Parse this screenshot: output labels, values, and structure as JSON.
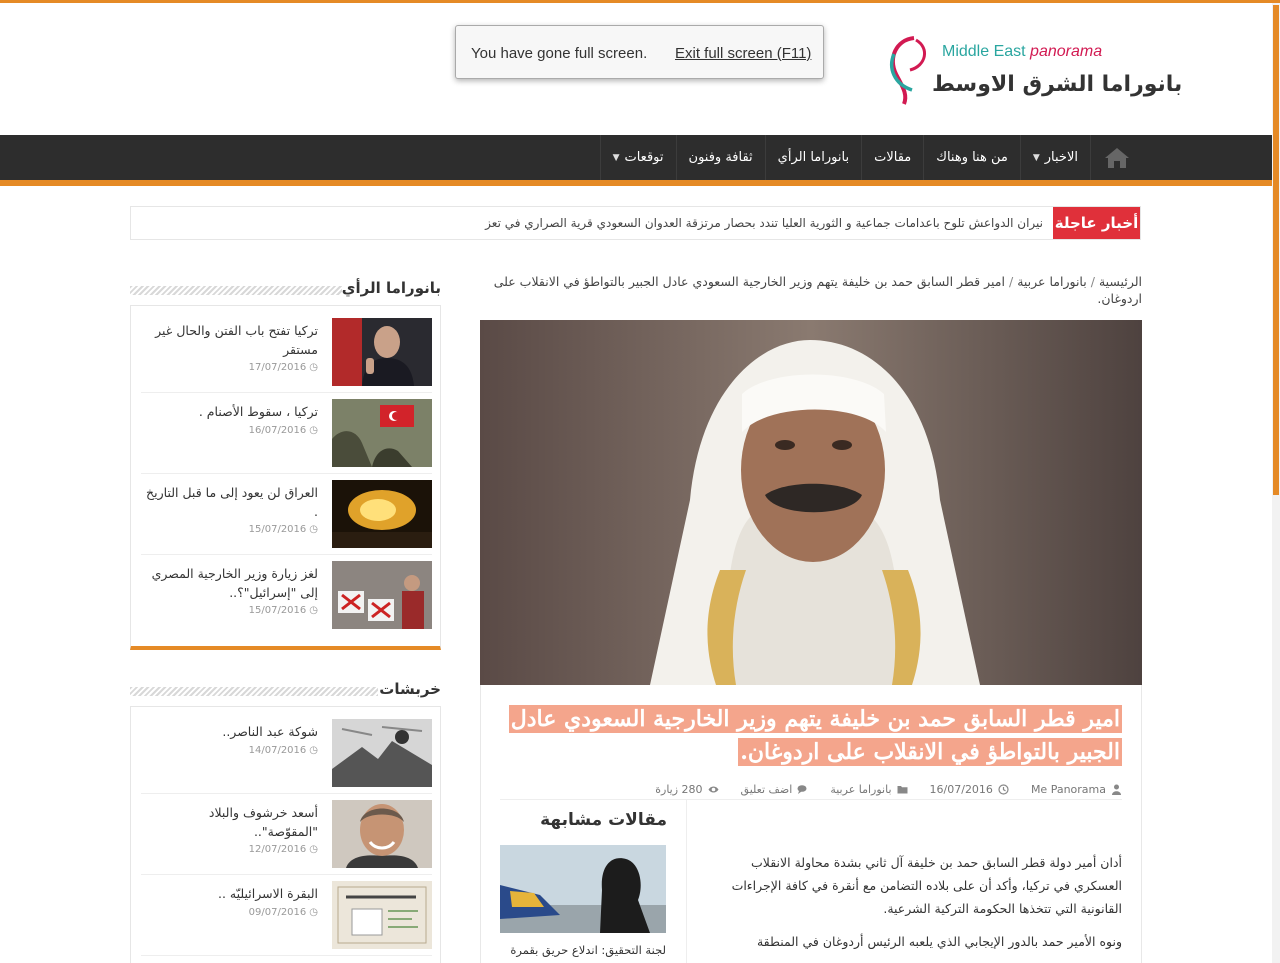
{
  "fullscreen_notice": {
    "message": "You have gone full screen.",
    "exit_label": "Exit full screen (F11)"
  },
  "logo": {
    "en_part1": "Middle East",
    "en_part2": "panorama",
    "ar": "بانوراما الشرق الاوسط"
  },
  "nav": {
    "items": [
      {
        "label": "الاخبار",
        "has_dropdown": true
      },
      {
        "label": "من هنا وهناك",
        "has_dropdown": false
      },
      {
        "label": "مقالات",
        "has_dropdown": false
      },
      {
        "label": "بانوراما الرأي",
        "has_dropdown": false
      },
      {
        "label": "ثقافة وفنون",
        "has_dropdown": false
      },
      {
        "label": "توقعات",
        "has_dropdown": true
      }
    ]
  },
  "breaking": {
    "label": "أخبار عاجلة",
    "text": "نيران الدواعش تلوح باعدامات جماعية و الثورية العليا تندد بحصار مرتزقة العدوان السعودي قرية الصراري في تعز"
  },
  "breadcrumb": {
    "home": "الرئيسية",
    "category": "بانوراما عربية",
    "current": "امير قطر السابق حمد بن خليفة يتهم وزير الخارجية السعودي عادل الجبير بالتواطؤ في الانقلاب على اردوغان."
  },
  "article": {
    "title": "امير قطر السابق حمد بن خليفة يتهم وزير الخارجية السعودي عادل الجبير بالتواطؤ في الانقلاب على اردوغان.",
    "author": "Me Panorama",
    "date": "16/07/2016",
    "category": "بانوراما عربية",
    "comment_label": "اضف تعليق",
    "views": "280 زيارة",
    "paragraphs": [
      "أدان أمير دولة قطر السابق حمد بن خليفة آل ثاني بشدة محاولة الانقلاب العسكري في تركيا، وأكد أن على بلاده التضامن مع أنقرة في كافة الإجراءات القانونية التي تتخذها الحكومة التركية الشرعية.",
      "ونوه الأمير حمد بالدور الإيجابي الذي يلعبه الرئيس أردوغان في المنطقة"
    ]
  },
  "related": {
    "title": "مقالات مشابهة",
    "item_caption": "لجنة التحقيق: اندلاع حريق بقمرة"
  },
  "sidebar": {
    "widget1": {
      "title": "بانوراما الرأي",
      "items": [
        {
          "title": "تركيا تفتح باب الفتن والحال غير مستقر",
          "date": "17/07/2016"
        },
        {
          "title": "تركيا ، سقوط الأصنام .",
          "date": "16/07/2016"
        },
        {
          "title": "العراق لن يعود إلى ما قبل التاريخ .",
          "date": "15/07/2016"
        },
        {
          "title": "لغز زيارة وزير الخارجية المصري إلى \"إسرائيل\"؟..",
          "date": "15/07/2016"
        }
      ]
    },
    "widget2": {
      "title": "خربشات",
      "items": [
        {
          "title": "شوكة عبد الناصر..",
          "date": "14/07/2016"
        },
        {
          "title": "أسعد خرشوف والبلاد \"المقوّصة\"..",
          "date": "12/07/2016"
        },
        {
          "title": "البقرة الاسرائيليّه ..",
          "date": "09/07/2016"
        }
      ]
    }
  },
  "colors": {
    "accent": "#e58a26",
    "breaking": "#e0303a",
    "nav_bg": "#2d2d2d",
    "title_highlight": "#f4a58c"
  }
}
